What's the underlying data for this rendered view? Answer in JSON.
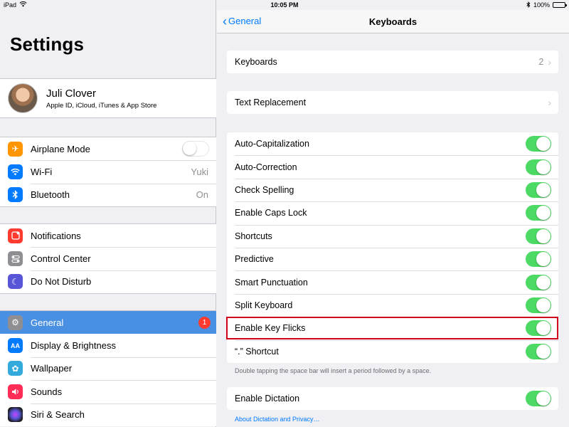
{
  "status": {
    "device": "iPad",
    "time": "10:05 PM",
    "battery": "100%"
  },
  "sidebar": {
    "title": "Settings",
    "profile": {
      "name": "Juli Clover",
      "subtitle": "Apple ID, iCloud, iTunes & App Store"
    },
    "group1": [
      {
        "label": "Airplane Mode",
        "icon": "airplane-icon",
        "color": "#ff9500",
        "toggle": false
      },
      {
        "label": "Wi-Fi",
        "icon": "wifi-icon",
        "color": "#007aff",
        "value": "Yuki"
      },
      {
        "label": "Bluetooth",
        "icon": "bluetooth-icon",
        "color": "#007aff",
        "value": "On"
      }
    ],
    "group2": [
      {
        "label": "Notifications",
        "icon": "notifications-icon",
        "color": "#ff3b30"
      },
      {
        "label": "Control Center",
        "icon": "control-center-icon",
        "color": "#8e8e93"
      },
      {
        "label": "Do Not Disturb",
        "icon": "moon-icon",
        "color": "#5856d6"
      }
    ],
    "group3": [
      {
        "label": "General",
        "icon": "gear-icon",
        "color": "#8e8e93",
        "badge": "1",
        "selected": true
      },
      {
        "label": "Display & Brightness",
        "icon": "display-icon",
        "color": "#007aff"
      },
      {
        "label": "Wallpaper",
        "icon": "wallpaper-icon",
        "color": "#34aadc"
      },
      {
        "label": "Sounds",
        "icon": "sounds-icon",
        "color": "#ff2d55"
      },
      {
        "label": "Siri & Search",
        "icon": "siri-icon",
        "color": "#1c1c1e"
      }
    ]
  },
  "nav": {
    "back_label": "General",
    "title": "Keyboards"
  },
  "keyboards_row": {
    "label": "Keyboards",
    "value": "2"
  },
  "text_replacement": {
    "label": "Text Replacement"
  },
  "toggles": [
    {
      "label": "Auto-Capitalization",
      "on": true
    },
    {
      "label": "Auto-Correction",
      "on": true
    },
    {
      "label": "Check Spelling",
      "on": true
    },
    {
      "label": "Enable Caps Lock",
      "on": true
    },
    {
      "label": "Shortcuts",
      "on": true
    },
    {
      "label": "Predictive",
      "on": true
    },
    {
      "label": "Smart Punctuation",
      "on": true
    },
    {
      "label": "Split Keyboard",
      "on": true
    },
    {
      "label": "Enable Key Flicks",
      "on": true,
      "highlighted": true
    },
    {
      "label": "“.” Shortcut",
      "on": true
    }
  ],
  "shortcut_note": "Double tapping the space bar will insert a period followed by a space.",
  "dictation": {
    "label": "Enable Dictation",
    "on": true
  },
  "dictation_link": "About Dictation and Privacy…",
  "colors": {
    "accent": "#007aff",
    "toggle_on": "#4cd964",
    "selection": "#4a90e2",
    "highlight_border": "#d0021b"
  }
}
